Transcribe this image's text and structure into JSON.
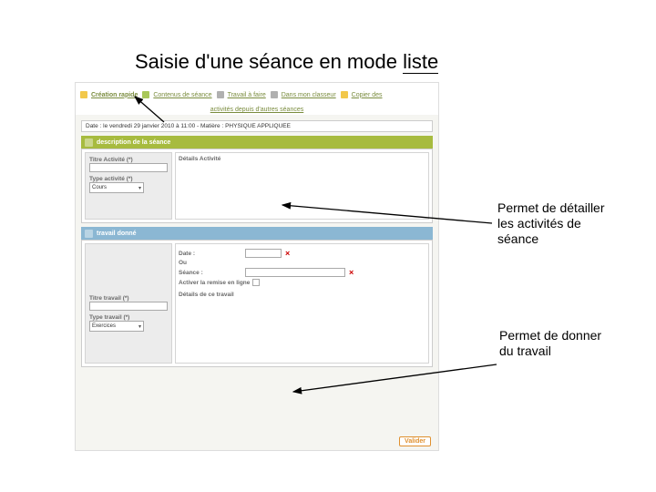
{
  "title_prefix": "Saisie d'une séance en mode ",
  "title_underlined": "liste",
  "toolbar": {
    "creation": "Création rapide",
    "contents": "Contenus de séance",
    "homework": "Travail à faire",
    "classroom": "Dans mon classeur",
    "copy": "Copier des",
    "sub": "activités depuis d'autres séances"
  },
  "date_bar": "Date : le vendredi 29 janvier 2010 à 11:00 - Matière : PHYSIQUE APPLIQUEE",
  "section1": {
    "header": "description de la séance",
    "details_label": "Détails Activité",
    "title_label": "Titre Activité (*)",
    "type_label": "Type activité (*)",
    "type_value": "Cours"
  },
  "section2": {
    "header": "travail donné",
    "date_lbl": "Date :",
    "ou": "Ou",
    "seance_lbl": "Séance :",
    "online_lbl": "Activer la remise en ligne",
    "title_label": "Titre travail (*)",
    "type_label": "Type travail (*)",
    "type_value": "Exercices",
    "details_label": "Détails de ce travail"
  },
  "validate": "Valider",
  "annotations": {
    "a1": "Permet de détailler les activités de séance",
    "a2": "Permet de donner du travail"
  }
}
